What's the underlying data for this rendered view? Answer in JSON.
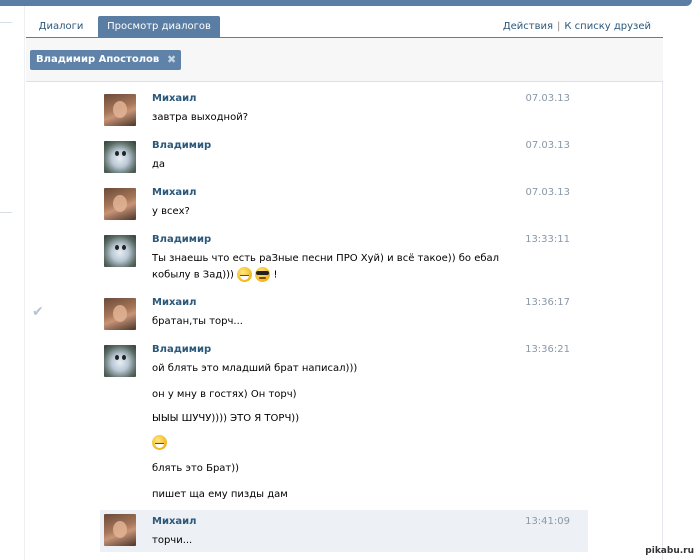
{
  "tabs": {
    "dialogs": "Диалоги",
    "view_dialogs": "Просмотр диалогов"
  },
  "header_actions": {
    "actions": "Действия",
    "separator": "|",
    "friends_list": "К списку друзей"
  },
  "filter": {
    "chip_label": "Владимир Апостолов",
    "chip_close": "✖"
  },
  "messages": [
    {
      "author": "Михаил",
      "time": "07.03.13",
      "lines": [
        "завтра выходной?"
      ]
    },
    {
      "author": "Владимир",
      "time": "07.03.13",
      "lines": [
        "да"
      ]
    },
    {
      "author": "Михаил",
      "time": "07.03.13",
      "lines": [
        "у всех?"
      ]
    },
    {
      "author": "Владимир",
      "time": "13:33:11",
      "lines": [
        "Ты знаешь что есть раЗные песни ПРО Хуй) и всё такое)) бо ебал",
        "кобылу в Зад)))",
        "!"
      ]
    },
    {
      "author": "Михаил",
      "time": "13:36:17",
      "lines": [
        "братан,ты торч..."
      ]
    },
    {
      "author": "Владимир",
      "time": "13:36:21",
      "lines": [
        "ой блять это младший брат написал)))",
        "он у мну в гостях) Он торч)",
        "ЫЫЫ ШУЧУ)))) ЭТО Я ТОРЧ))",
        "блять это Брат))",
        "пишет ща ему пизды дам"
      ]
    },
    {
      "author": "Михаил",
      "time": "13:41:09",
      "lines": [
        "торчи..."
      ]
    }
  ],
  "icons": {
    "checkmark": "✔",
    "emoji_grin": "grin-emoji",
    "emoji_cool": "sunglasses-emoji",
    "emoji_smile": "smile-emoji"
  },
  "colors": {
    "accent": "#597da3",
    "link": "#2b587a",
    "highlight_row": "#edf1f5"
  },
  "watermark": "pikabu.ru"
}
